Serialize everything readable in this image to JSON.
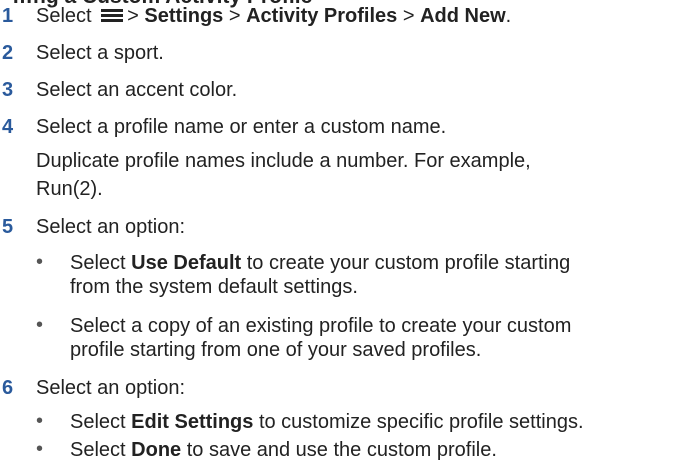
{
  "heading_fragment": "…ng a Custom Activity Profile",
  "steps": [
    {
      "num": "1",
      "parts": [
        "Select",
        "> ",
        "Settings",
        " > ",
        "Activity Profiles",
        " > ",
        "Add New",
        "."
      ]
    },
    {
      "num": "2",
      "text": "Select a sport."
    },
    {
      "num": "3",
      "text": "Select an accent color."
    },
    {
      "num": "4",
      "text": "Select a profile name or enter a custom name.",
      "note_lines": [
        "Duplicate profile names include a number. For example,",
        "Run(2)."
      ]
    },
    {
      "num": "5",
      "text": "Select an option:",
      "bullets": [
        {
          "pre": "Select ",
          "bold": "Use Default",
          "post": " to create your custom profile starting",
          "line2": "from the system default settings."
        },
        {
          "line1": "Select a copy of an existing profile to create your custom",
          "line2": "profile starting from one of your saved profiles."
        }
      ]
    },
    {
      "num": "6",
      "text": "Select an option:",
      "bullets": [
        {
          "pre": "Select ",
          "bold": "Edit Settings",
          "post": " to customize specific profile settings."
        },
        {
          "pre": "Select ",
          "bold": "Done",
          "post": " to save and use the custom profile."
        }
      ]
    }
  ],
  "icons": {
    "menu": "hamburger-menu-icon"
  },
  "colors": {
    "step_number": "#2a5a9c",
    "text": "#222222"
  }
}
